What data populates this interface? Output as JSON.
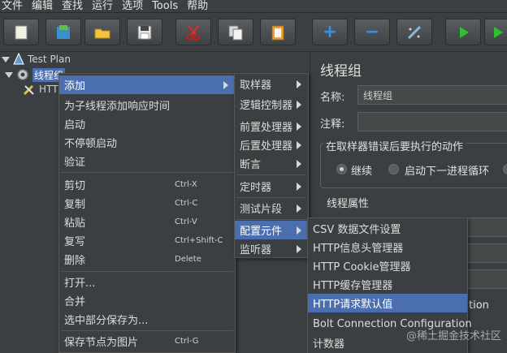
{
  "menubar": [
    "文件",
    "编辑",
    "查找",
    "运行",
    "选项",
    "Tools",
    "帮助"
  ],
  "toolbar": {
    "buttons": [
      "new-icon",
      "templates-icon",
      "open-icon",
      "save-icon",
      "cut-icon",
      "copy-icon",
      "paste-icon",
      "add-icon",
      "remove-icon",
      "toggle-icon",
      "start-icon",
      "start-no-pause-icon"
    ],
    "add_symbol": "+",
    "remove_symbol": "−"
  },
  "tree": {
    "test_plan": "Test Plan",
    "thread_group": "线程组",
    "http_child": "HTT"
  },
  "right_panel": {
    "title": "线程组",
    "name_label": "名称:",
    "name_value": "线程组",
    "comment_label": "注释:",
    "error_group_title": "在取样器错误后要执行的动作",
    "radio_continue": "继续",
    "radio_next_loop": "启动下一进程循环",
    "thread_props": "线程属性",
    "partial_text": "tion"
  },
  "context_menu": {
    "items": [
      {
        "label": "添加",
        "shortcut": "",
        "submenu": true
      },
      {
        "label": "为子线程添加响应时间",
        "shortcut": ""
      },
      {
        "label": "启动",
        "shortcut": ""
      },
      {
        "label": "不停顿启动",
        "shortcut": ""
      },
      {
        "label": "验证",
        "shortcut": ""
      },
      {
        "label": "剪切",
        "shortcut": "Ctrl-X"
      },
      {
        "label": "复制",
        "shortcut": "Ctrl-C"
      },
      {
        "label": "粘贴",
        "shortcut": "Ctrl-V"
      },
      {
        "label": "复写",
        "shortcut": "Ctrl+Shift-C"
      },
      {
        "label": "删除",
        "shortcut": "Delete"
      },
      {
        "label": "打开...",
        "shortcut": ""
      },
      {
        "label": "合并",
        "shortcut": ""
      },
      {
        "label": "选中部分保存为...",
        "shortcut": ""
      },
      {
        "label": "保存节点为图片",
        "shortcut": "Ctrl-G"
      }
    ]
  },
  "add_submenu": {
    "items": [
      "取样器",
      "逻辑控制器",
      "前置处理器",
      "后置处理器",
      "断言",
      "定时器",
      "测试片段",
      "配置元件",
      "监听器"
    ]
  },
  "config_submenu": {
    "items": [
      "CSV 数据文件设置",
      "HTTP信息头管理器",
      "HTTP Cookie管理器",
      "HTTP缓存管理器",
      "HTTP请求默认值",
      "Bolt Connection Configuration",
      "计数器"
    ]
  },
  "watermark": "@稀土掘金技术社区",
  "colors": {
    "highlight": "#4b6eaf",
    "background": "#3c3f41"
  }
}
